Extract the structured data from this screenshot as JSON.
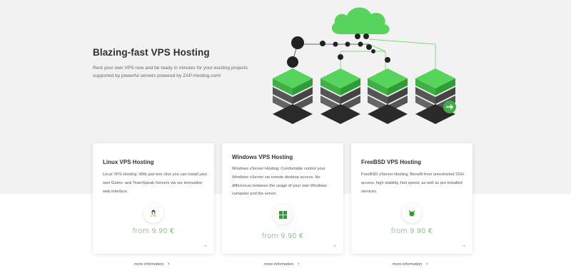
{
  "hero": {
    "title": "Blazing-fast VPS Hosting",
    "subtitle_line1": "Rent your own VPS now and be ready in minutes for your exciting projects",
    "subtitle_line2": "supported by powerful servers powered by ZAP-Hosting.com!"
  },
  "colors": {
    "accent": "#57d45b",
    "accent_dark": "#2e9e34",
    "hero_bg": "#f2f2f2"
  },
  "cards": [
    {
      "title": "Linux VPS Hosting",
      "desc": "Linux VPS Hosting: With just one click you can install your own Game- and TeamSpeak-Servers via our innovative web interface.",
      "icon": "linux-icon",
      "price": "from 9.90 €",
      "more": "more information"
    },
    {
      "title": "Windows VPS Hosting",
      "desc": "Windows vServer Hosting: Comfortable control your Windows vServer via remote desktop access. No differences between the usage of your own Windows computer and the server.",
      "icon": "windows-icon",
      "price": "from 9.90 €",
      "more": "more information"
    },
    {
      "title": "FreeBSD VPS Hosting",
      "desc": "FreeBSD vServer Hosting: Benefit from unrestricted SSH access, high stability, fast speed, as well as pre-installed services.",
      "icon": "freebsd-icon",
      "price": "from 9.90 €",
      "more": "more information"
    }
  ]
}
